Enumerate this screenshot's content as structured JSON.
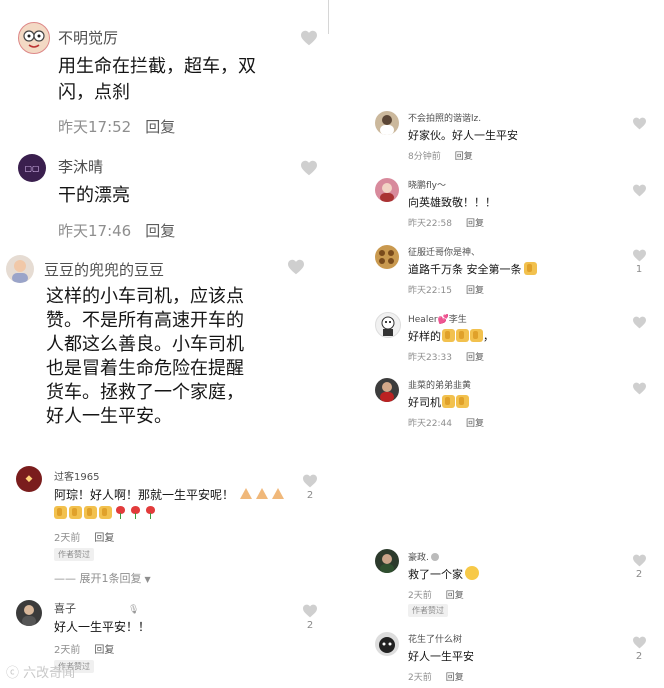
{
  "left_comments": [
    {
      "name": "不明觉厉",
      "lines": [
        "用生命在拦截，超车，双",
        "闪，点刹"
      ],
      "time": "昨天17:52",
      "reply": "回复"
    },
    {
      "name": "李沐晴",
      "lines": [
        "干的漂亮"
      ],
      "time": "昨天17:46",
      "reply": "回复"
    },
    {
      "name": "豆豆的兜兜的豆豆",
      "lines": [
        "这样的小车司机，应该点",
        "赞。不是所有高速开车的",
        "人都这么善良。小车司机",
        "也是冒着生命危险在提醒",
        "货车。拯救了一个家庭，",
        "好人一生平安。"
      ]
    },
    {
      "name": "过客1965",
      "text": "阿琮！好人啊！那就一生平安呢！",
      "time": "2天前",
      "reply": "回复",
      "tag": "作者赞过",
      "likes": "2"
    },
    {
      "name": "喜子",
      "text": "好人一生平安！！",
      "time": "2天前",
      "reply": "回复",
      "tag": "作者赞过",
      "likes": "2"
    }
  ],
  "expand_replies": "—— 展开1条回复",
  "right_comments": [
    {
      "name": "不会拍照的谐谐lz.",
      "text": "好家伙。好人一生平安",
      "time": "8分钟前",
      "reply": "回复"
    },
    {
      "name": "晓鹏fly～",
      "text": "向英雄致敬！！！",
      "time": "昨天22:58",
      "reply": "回复"
    },
    {
      "name": "征服迁哥你是神、",
      "text": "道路千万条 安全第一条",
      "time": "昨天22:15",
      "reply": "回复",
      "likes": "1"
    },
    {
      "name": "Healer💕李生",
      "text": "好样的",
      "time": "昨天23:33",
      "reply": "回复"
    },
    {
      "name": "韭菜的弟弟韭黄",
      "text": "好司机",
      "time": "昨天22:44",
      "reply": "回复"
    },
    {
      "name": "豪政.",
      "text": "救了一个家",
      "time": "2天前",
      "reply": "回复",
      "tag": "作者赞过",
      "likes": "2"
    },
    {
      "name": "花生了什么树",
      "text": "好人一生平安",
      "time": "2天前",
      "reply": "回复",
      "likes": "2"
    }
  ],
  "watermark": "六改奇闻",
  "colors": {
    "heart": "#cfcfcf",
    "text": "#151515",
    "meta": "#8e8e8e"
  }
}
